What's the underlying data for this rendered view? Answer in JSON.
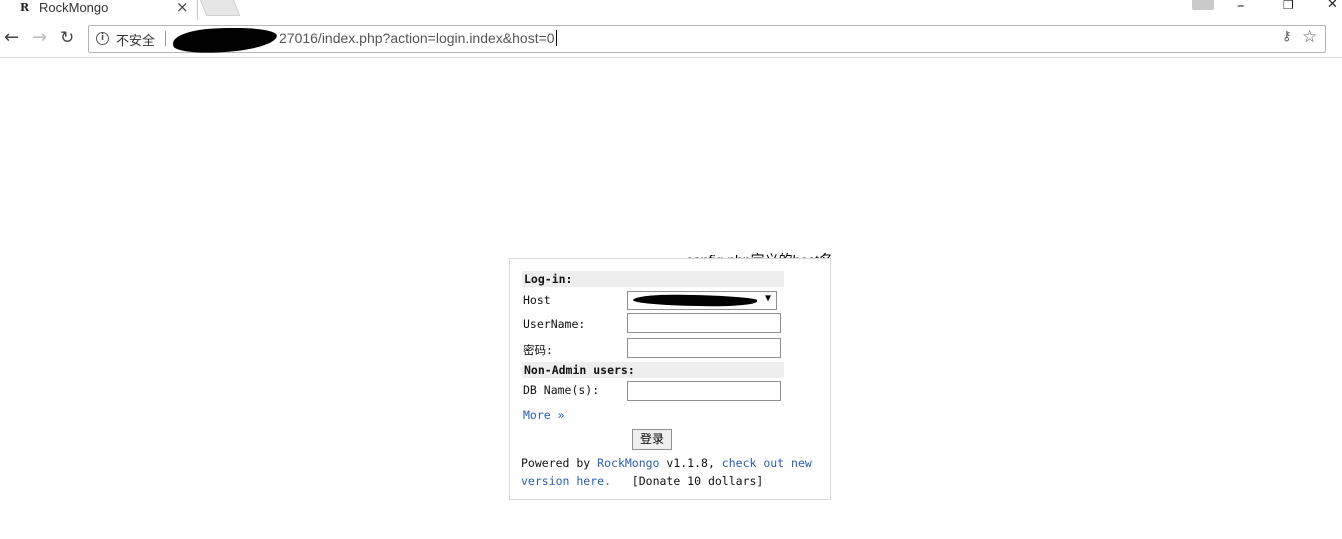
{
  "browser": {
    "tab_favicon": "R",
    "tab_title": "RockMongo",
    "tab_close": "×",
    "security_label": "不安全",
    "url_visible": "27016/index.php?action=login.index&host=0",
    "window_controls": {
      "minimize": "–",
      "restore": "❐",
      "close": "✕"
    },
    "icons": [
      "back-arrow-icon",
      "forward-arrow-icon",
      "reload-icon",
      "info-icon",
      "key-icon",
      "star-icon"
    ]
  },
  "annotation": "config.php定义的host名",
  "login": {
    "section_login": "Log-in:",
    "host_label": "Host",
    "host_selected": "",
    "username_label": "UserName:",
    "username_value": "",
    "password_label": "密码:",
    "password_value": "",
    "section_nonadmin": "Non-Admin users:",
    "dbname_label": "DB Name(s):",
    "dbname_value": "",
    "more_link": "More »",
    "submit_label": "登录"
  },
  "footer": {
    "powered_by": "Powered by ",
    "rockmongo_link": "RockMongo",
    "version": " v1.1.8, ",
    "check_link": "check out new version here.",
    "donate": "[Donate 10 dollars]"
  }
}
